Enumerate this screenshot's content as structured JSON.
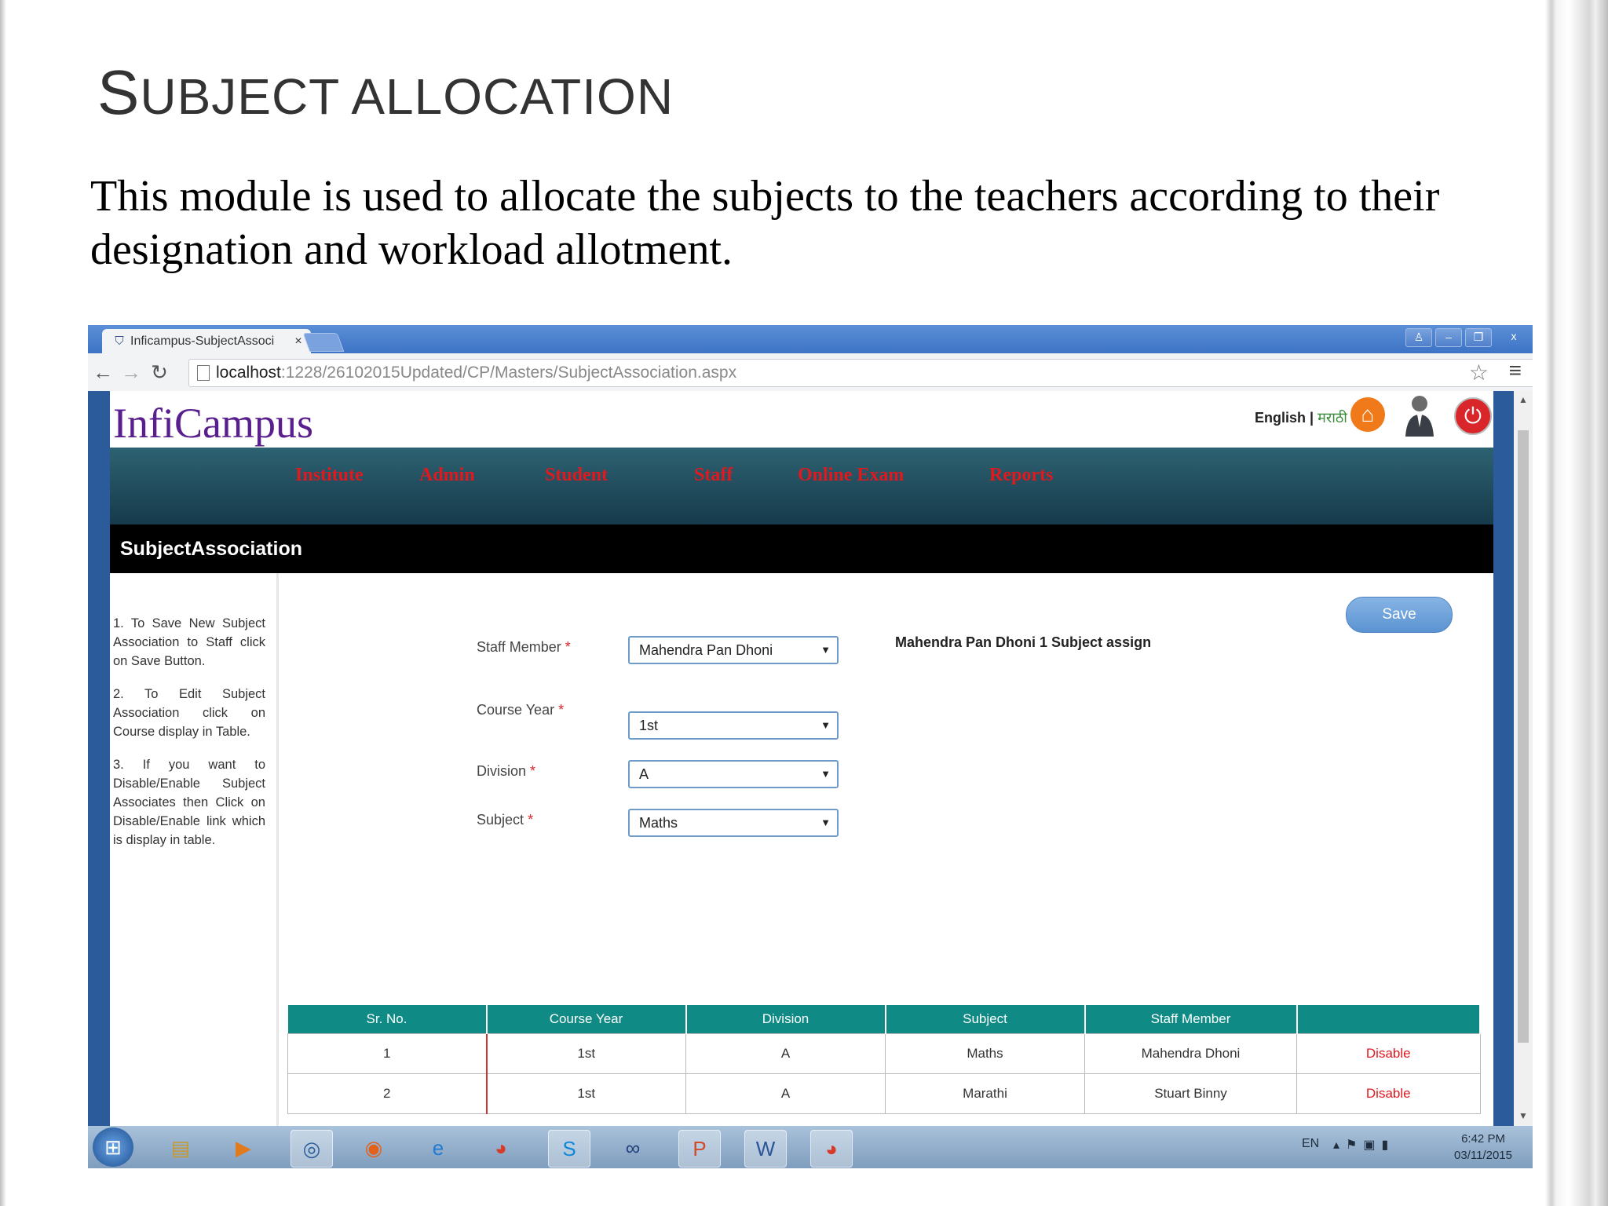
{
  "slide": {
    "title_first": "S",
    "title_rest": "UBJECT ALLOCATION",
    "description": "This module is used to allocate the subjects to the teachers according to their designation and workload allotment."
  },
  "browser": {
    "tab_title": "Inficampus-SubjectAssoci",
    "tab_close": "×",
    "url_host": "localhost",
    "url_path": ":1228/26102015Updated/CP/Masters/SubjectAssociation.aspx"
  },
  "app": {
    "logo": "InfiCampus",
    "lang_english": "English",
    "lang_sep": " | ",
    "lang_marathi": "मराठी",
    "nav": [
      "Institute",
      "Admin",
      "Student",
      "Staff",
      "Online Exam",
      "Reports"
    ],
    "page_title": "SubjectAssociation",
    "help": [
      "1. To Save New Subject Association to Staff click on Save Button.",
      "2. To Edit Subject Association click on Course display in Table.",
      "3. If you want to Disable/Enable Subject Associates then Click on Disable/Enable link which is display in table."
    ],
    "form": {
      "staff_label": "Staff Member",
      "staff_value": "Mahendra Pan Dhoni",
      "course_label": "Course Year",
      "course_value": "1st",
      "division_label": "Division",
      "division_value": "A",
      "subject_label": "Subject",
      "subject_value": "Maths",
      "required_mark": "*",
      "assign_note": "Mahendra Pan Dhoni 1 Subject assign",
      "save_label": "Save"
    },
    "table": {
      "headers": [
        "Sr. No.",
        "Course Year",
        "Division",
        "Subject",
        "Staff Member",
        ""
      ],
      "rows": [
        [
          "1",
          "1st",
          "A",
          "Maths",
          "Mahendra Dhoni",
          "Disable"
        ],
        [
          "2",
          "1st",
          "A",
          "Marathi",
          "Stuart Binny",
          "Disable"
        ]
      ]
    }
  },
  "taskbar": {
    "lang": "EN",
    "time": "6:42 PM",
    "date": "03/11/2015"
  },
  "colors": {
    "nav_text": "#e0191f",
    "table_header": "#0f8a84",
    "logo": "#5a1f8f",
    "save_button": "#5b93d2"
  }
}
